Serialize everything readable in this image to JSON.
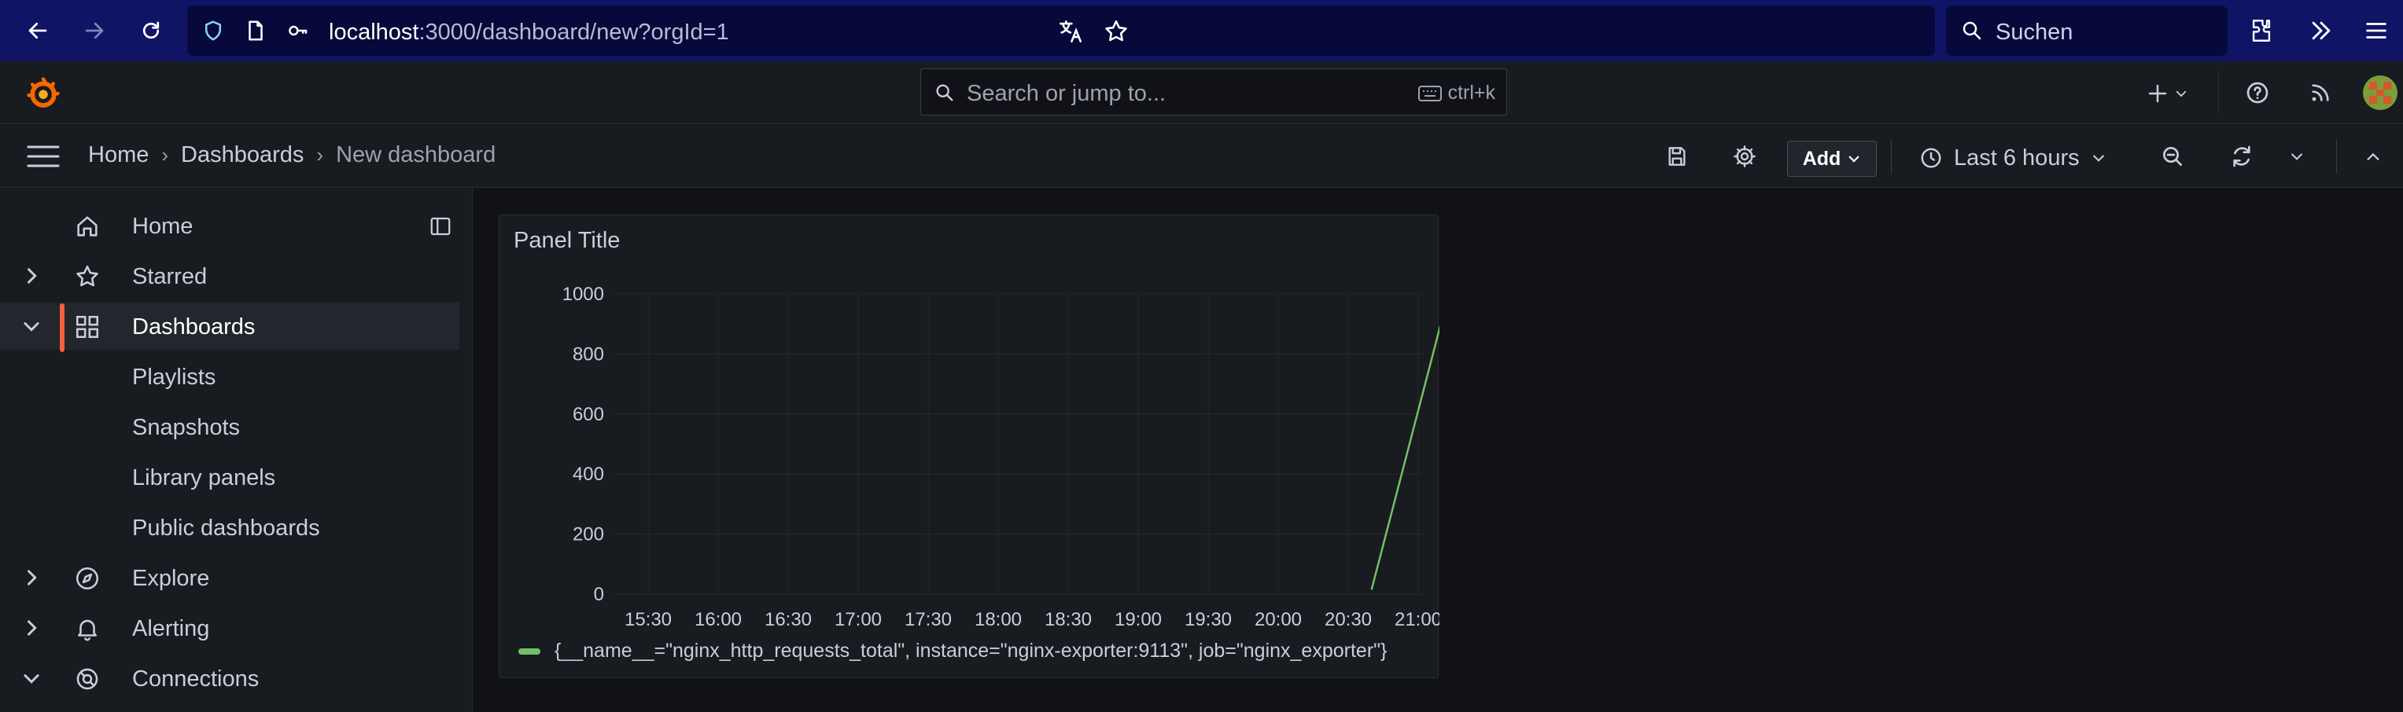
{
  "browser": {
    "url_host": "localhost",
    "url_path": ":3000/dashboard/new?orgId=1",
    "search_placeholder": "Suchen"
  },
  "topbar": {
    "search_placeholder": "Search or jump to...",
    "search_shortcut": "ctrl+k"
  },
  "breadcrumb": {
    "items": [
      "Home",
      "Dashboards"
    ],
    "current": "New dashboard"
  },
  "toolbar": {
    "add_label": "Add",
    "time_range": "Last 6 hours"
  },
  "sidebar": {
    "items": [
      {
        "label": "Home",
        "icon": "home-icon",
        "chevron": "none"
      },
      {
        "label": "Starred",
        "icon": "star-icon",
        "chevron": "right"
      },
      {
        "label": "Dashboards",
        "icon": "dashboards-grid-icon",
        "chevron": "down",
        "active": true
      },
      {
        "label": "Playlists",
        "sub": true
      },
      {
        "label": "Snapshots",
        "sub": true
      },
      {
        "label": "Library panels",
        "sub": true
      },
      {
        "label": "Public dashboards",
        "sub": true
      },
      {
        "label": "Explore",
        "icon": "compass-icon",
        "chevron": "right"
      },
      {
        "label": "Alerting",
        "icon": "bell-icon",
        "chevron": "right"
      },
      {
        "label": "Connections",
        "icon": "connections-icon",
        "chevron": "down"
      }
    ]
  },
  "colors": {
    "accent": "#f55f3e",
    "series": "#73bf69",
    "browser_bar": "#0f1465"
  },
  "panel": {
    "title": "Panel Title",
    "chart_data": {
      "type": "line",
      "x_ticks": [
        "15:30",
        "16:00",
        "16:30",
        "17:00",
        "17:30",
        "18:00",
        "18:30",
        "19:00",
        "19:30",
        "20:00",
        "20:30",
        "21:00"
      ],
      "y_ticks": [
        "0",
        "200",
        "400",
        "600",
        "800",
        "1000"
      ],
      "ylim": [
        0,
        1000
      ],
      "grid": true,
      "legend_position": "bottom",
      "series": [
        {
          "name": "{__name__=\"nginx_http_requests_total\", instance=\"nginx-exporter:9113\", job=\"nginx_exporter\"}",
          "color": "#73bf69",
          "points": [
            {
              "x": "20:40",
              "y": 15
            },
            {
              "x": "21:10",
              "y": 910
            }
          ]
        }
      ]
    }
  }
}
